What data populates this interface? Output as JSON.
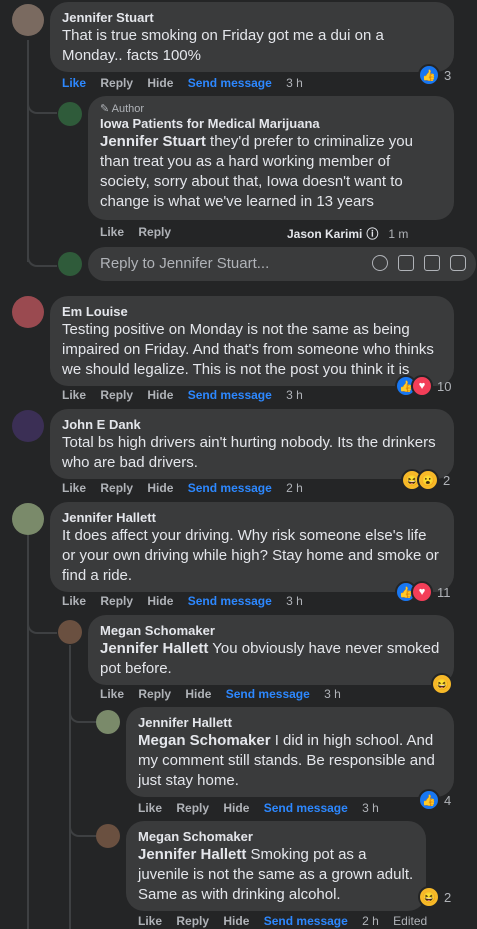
{
  "actions": {
    "like": "Like",
    "reply": "Reply",
    "hide": "Hide",
    "send": "Send message",
    "edited": "Edited"
  },
  "comments": [
    {
      "name": "Jennifer Stuart",
      "text": "That is true smoking on Friday got me a dui on a Monday.. facts 100%",
      "time": "3 h",
      "react_count": "3",
      "avatar_color": "#7a6a60"
    },
    {
      "badge": "Author",
      "name": "Iowa Patients for Medical Marijuana",
      "mention": "Jennifer Stuart",
      "text": " they'd prefer to criminalize you than treat you as a hard working member of society, sorry about that, Iowa doesn't want to change is what we've learned in 13 years",
      "replier": "Jason Karimi",
      "time": "1 m",
      "avatar_color": "#2f5b3a"
    },
    {
      "placeholder": "Reply to Jennifer Stuart..."
    },
    {
      "name": "Em Louise",
      "text": "Testing positive on Monday is not the same as being impaired on Friday. And that's from someone who thinks we should legalize. This is not the post you think it is",
      "time": "3 h",
      "react_count": "10",
      "avatar_color": "#9a4a50"
    },
    {
      "name": "John E Dank",
      "text": "Total bs high drivers ain't hurting nobody. Its the drinkers who are bad drivers.",
      "time": "2 h",
      "react_count": "2",
      "avatar_color": "#3b2f55"
    },
    {
      "name": "Jennifer Hallett",
      "text": "It does affect your driving. Why risk someone else's life or your own driving while high? Stay home and smoke or find a ride.",
      "time": "3 h",
      "react_count": "11",
      "avatar_color": "#7a8a6a"
    },
    {
      "name": "Megan Schomaker",
      "mention": "Jennifer Hallett",
      "text": " You obviously have never smoked pot before.",
      "time": "3 h",
      "avatar_color": "#6a5040"
    },
    {
      "name": "Jennifer Hallett",
      "mention": "Megan Schomaker",
      "text": " I did in high school. And my comment still stands. Be responsible and just stay home.",
      "time": "3 h",
      "react_count": "4",
      "avatar_color": "#7a8a6a"
    },
    {
      "name": "Megan Schomaker",
      "mention": "Jennifer Hallett",
      "text": " Smoking pot as a juvenile is not the same as a grown adult. Same as with drinking alcohol.",
      "time": "2 h",
      "react_count": "2",
      "avatar_color": "#6a5040"
    }
  ],
  "colors": {
    "background": "#242526",
    "bubble": "#3a3b3c",
    "accent": "#2d88ff",
    "muted": "#b0b3b8",
    "text": "#e4e6eb"
  }
}
